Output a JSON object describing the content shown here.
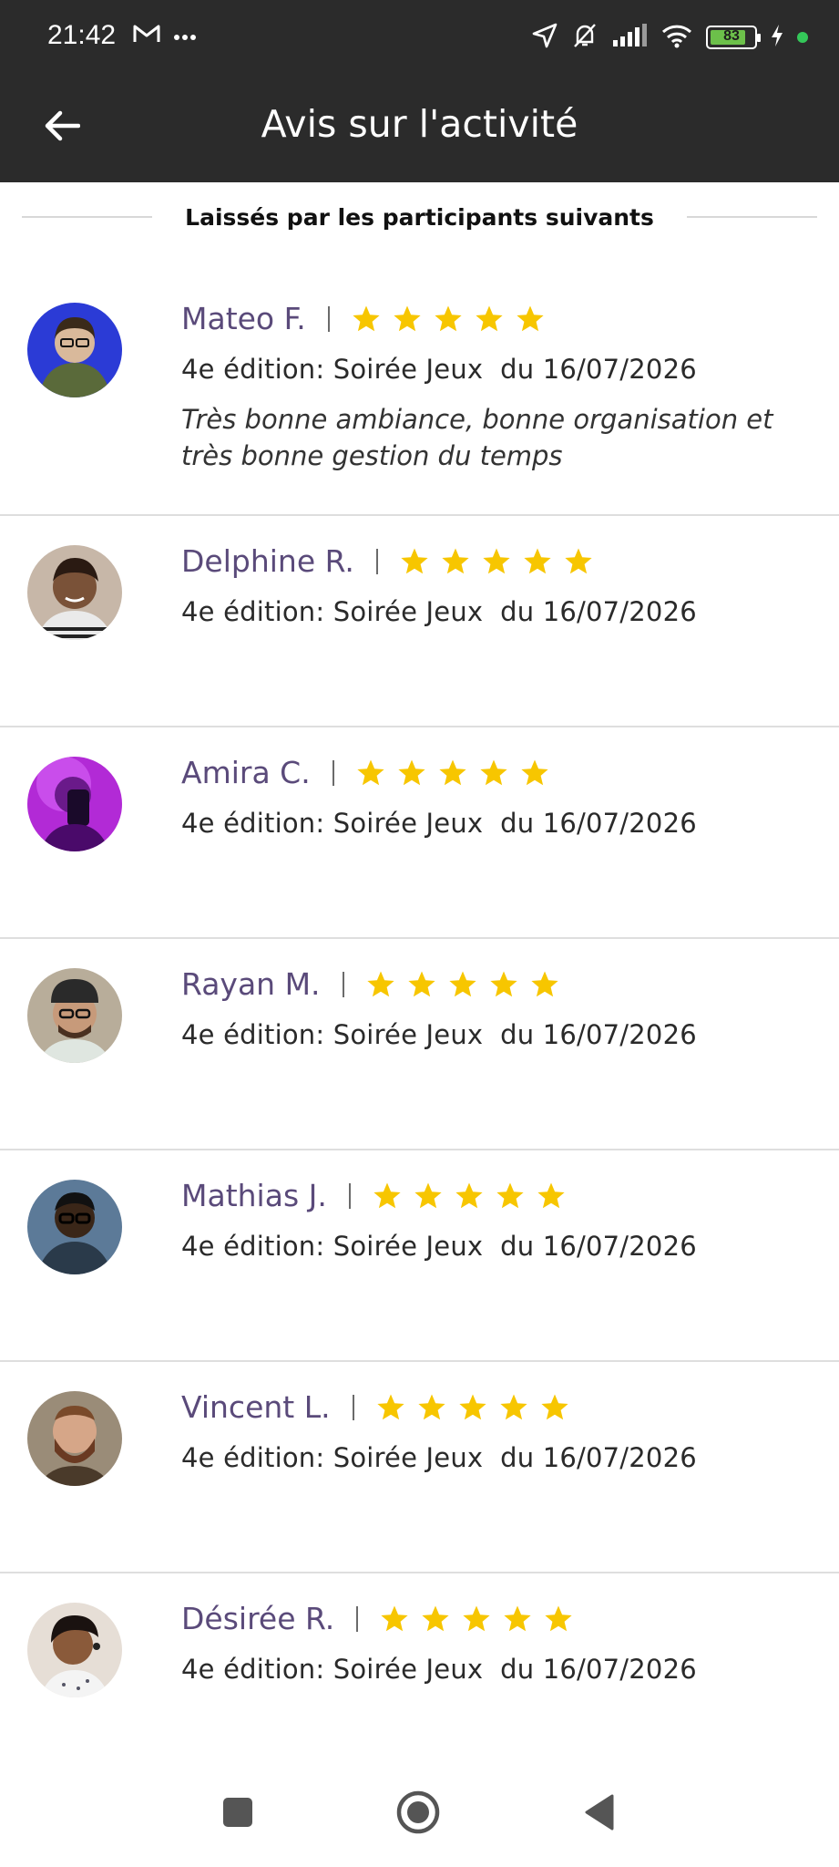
{
  "status_bar": {
    "time": "21:42",
    "battery_level": "83",
    "battery_fraction": 0.83,
    "icons": [
      "gmail-icon",
      "more-dots-icon",
      "location-arrow-icon",
      "bell-off-icon",
      "signal-icon",
      "wifi-icon",
      "battery-icon",
      "charging-icon"
    ],
    "dot_color": "#34c759"
  },
  "app_bar": {
    "title": "Avis sur l'activité",
    "back_icon": "arrow-left-icon",
    "background": "#2b2b2b"
  },
  "section": {
    "title": "Laissés par les participants suivants"
  },
  "colors": {
    "name": "#5a4a7a",
    "star": "#f7c600"
  },
  "reviews": [
    {
      "name": "Mateo F.",
      "rating": 5,
      "edition": "4e édition: Soirée Jeux  du 16/07/2026",
      "comment": "Très bonne ambiance, bonne organisation et très bonne gestion du temps",
      "avatar_bg": "#2b3bd6"
    },
    {
      "name": "Delphine R.",
      "rating": 5,
      "edition": "4e édition: Soirée Jeux  du 16/07/2026",
      "comment": "",
      "avatar_bg": "#b8a49a"
    },
    {
      "name": "Amira C.",
      "rating": 5,
      "edition": "4e édition: Soirée Jeux  du 16/07/2026",
      "comment": "",
      "avatar_bg": "#b22ad6"
    },
    {
      "name": "Rayan M.",
      "rating": 5,
      "edition": "4e édition: Soirée Jeux  du 16/07/2026",
      "comment": "",
      "avatar_bg": "#9a8f80"
    },
    {
      "name": "Mathias J.",
      "rating": 5,
      "edition": "4e édition: Soirée Jeux  du 16/07/2026",
      "comment": "",
      "avatar_bg": "#4a6a8a"
    },
    {
      "name": "Vincent L.",
      "rating": 5,
      "edition": "4e édition: Soirée Jeux  du 16/07/2026",
      "comment": "",
      "avatar_bg": "#8a7a6a"
    },
    {
      "name": "Désirée R.",
      "rating": 5,
      "edition": "4e édition: Soirée Jeux  du 16/07/2026",
      "comment": "",
      "avatar_bg": "#d8cfc8"
    }
  ],
  "nav_bar": {
    "buttons": [
      "recents-square-icon",
      "home-circle-icon",
      "back-triangle-icon"
    ]
  }
}
